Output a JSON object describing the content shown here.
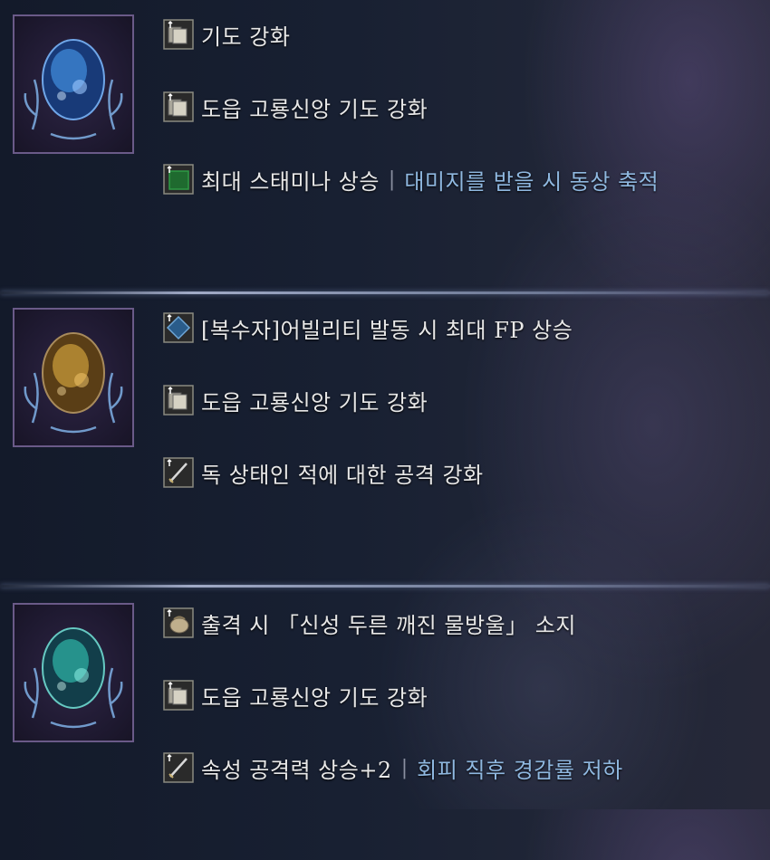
{
  "relics": [
    {
      "icon": "relic-blue-icon",
      "color": "#3f8ad8",
      "effects": [
        {
          "icon": "scroll-icon",
          "text": "기도 강화",
          "debuff": ""
        },
        {
          "icon": "scroll-icon",
          "text": "도읍 고룡신앙 기도 강화",
          "debuff": ""
        },
        {
          "icon": "green-square-icon",
          "text": "최대 스태미나 상승",
          "debuff": "대미지를 받을 시 동상 축적"
        }
      ]
    },
    {
      "icon": "relic-yellow-icon",
      "color": "#c79a3a",
      "effects": [
        {
          "icon": "blue-diamond-icon",
          "text": "[복수자]어빌리티 발동 시 최대 FP 상승",
          "debuff": ""
        },
        {
          "icon": "scroll-icon",
          "text": "도읍 고룡신앙 기도 강화",
          "debuff": ""
        },
        {
          "icon": "sword-icon",
          "text": "독 상태인 적에 대한 공격 강화",
          "debuff": ""
        }
      ]
    },
    {
      "icon": "relic-teal-icon",
      "color": "#2fb6a8",
      "effects": [
        {
          "icon": "pouch-icon",
          "text": "출격 시 「신성 두른 깨진 물방울」 소지",
          "debuff": ""
        },
        {
          "icon": "scroll-icon",
          "text": "도읍 고룡신앙 기도 강화",
          "debuff": ""
        },
        {
          "icon": "sword-icon",
          "text": "속성 공격력 상승+2",
          "debuff": "회피 직후 경감률 저하"
        }
      ]
    }
  ],
  "separator": "|"
}
